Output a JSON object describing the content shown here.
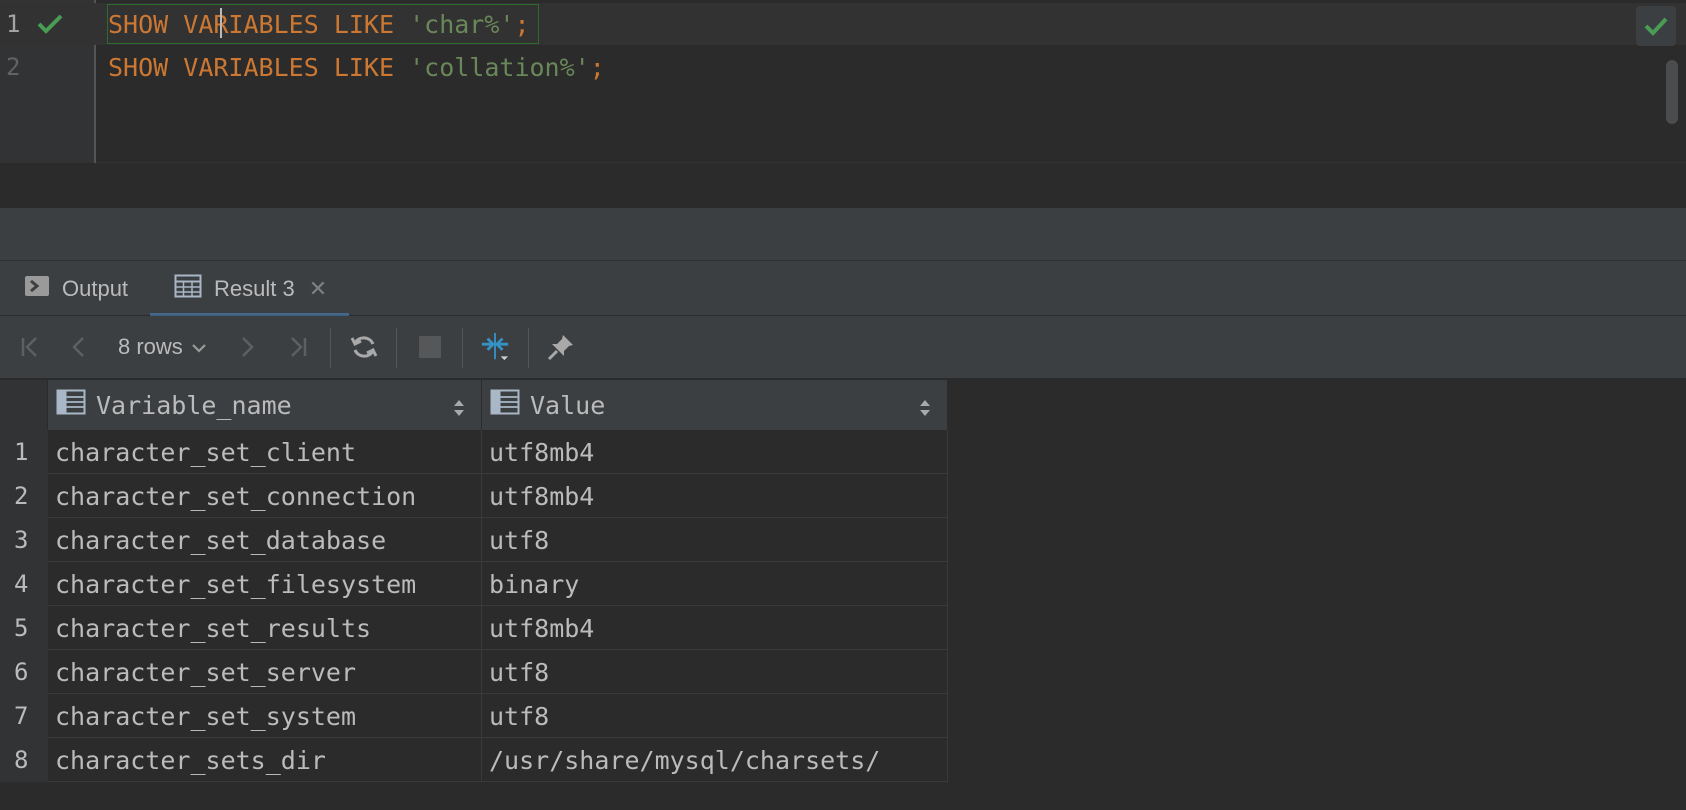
{
  "editor": {
    "lines": [
      {
        "number": "1",
        "tokens": [
          {
            "text": "SHOW",
            "kind": "kw"
          },
          {
            "text": " ",
            "kind": "ws"
          },
          {
            "text": "VARIABLES",
            "kind": "kw"
          },
          {
            "text": " ",
            "kind": "ws"
          },
          {
            "text": "LIKE",
            "kind": "kw"
          },
          {
            "text": " ",
            "kind": "ws"
          },
          {
            "text": "'char%'",
            "kind": "str"
          },
          {
            "text": ";",
            "kind": "punct"
          }
        ]
      },
      {
        "number": "2",
        "tokens": [
          {
            "text": "SHOW",
            "kind": "kw"
          },
          {
            "text": " ",
            "kind": "ws"
          },
          {
            "text": "VARIABLES",
            "kind": "kw"
          },
          {
            "text": " ",
            "kind": "ws"
          },
          {
            "text": "LIKE",
            "kind": "kw"
          },
          {
            "text": " ",
            "kind": "ws"
          },
          {
            "text": "'collation%'",
            "kind": "str"
          },
          {
            "text": ";",
            "kind": "punct"
          }
        ]
      }
    ]
  },
  "tabs": {
    "output_label": "Output",
    "result_label": "Result 3",
    "close_glyph": "✕"
  },
  "toolbar": {
    "rows_label": "8 rows"
  },
  "grid": {
    "columns": [
      "Variable_name",
      "Value"
    ],
    "rows": [
      {
        "n": "1",
        "name": "character_set_client",
        "value": "utf8mb4"
      },
      {
        "n": "2",
        "name": "character_set_connection",
        "value": "utf8mb4"
      },
      {
        "n": "3",
        "name": "character_set_database",
        "value": "utf8"
      },
      {
        "n": "4",
        "name": "character_set_filesystem",
        "value": "binary"
      },
      {
        "n": "5",
        "name": "character_set_results",
        "value": "utf8mb4"
      },
      {
        "n": "6",
        "name": "character_set_server",
        "value": "utf8"
      },
      {
        "n": "7",
        "name": "character_set_system",
        "value": "utf8"
      },
      {
        "n": "8",
        "name": "character_sets_dir",
        "value": "/usr/share/mysql/charsets/"
      }
    ]
  },
  "colors": {
    "keyword": "#cc7832",
    "string": "#6a8759",
    "success": "#499c54",
    "accent": "#3592c4",
    "background": "#2b2b2b",
    "panel": "#3c3f41"
  },
  "icons": {
    "gutter_status": "check-icon",
    "editor_status": "check-icon",
    "output_tab": "console-icon",
    "result_tab": "table-icon",
    "first_page": "first-page-icon",
    "prev_page": "previous-page-icon",
    "next_page": "next-page-icon",
    "last_page": "last-page-icon",
    "refresh": "refresh-icon",
    "stop": "stop-icon",
    "compare": "compare-icon",
    "pin": "pin-icon",
    "column": "column-icon",
    "sort": "sort-icon"
  }
}
